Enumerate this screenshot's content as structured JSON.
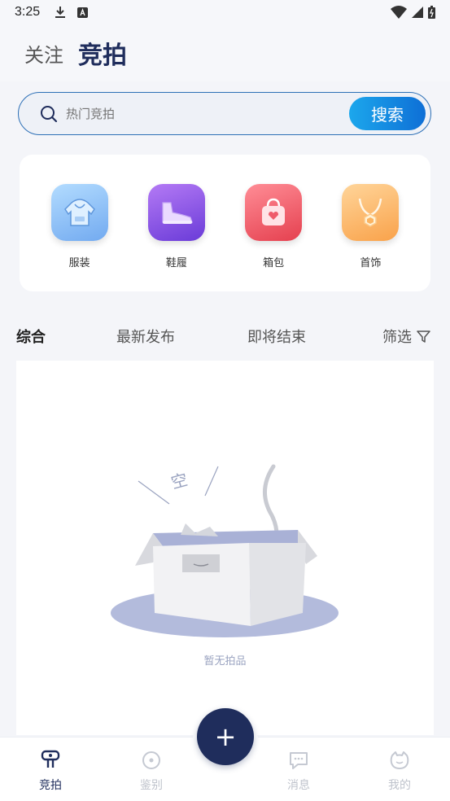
{
  "status_bar": {
    "time": "3:25"
  },
  "header": {
    "follow_label": "关注",
    "auction_label": "竞拍"
  },
  "search": {
    "placeholder": "热门竞拍",
    "button_label": "搜索"
  },
  "categories": [
    {
      "label": "服装",
      "icon": "hoodie-icon",
      "color": "#7fb8f5"
    },
    {
      "label": "鞋履",
      "icon": "sneaker-icon",
      "color": "#8a55e6"
    },
    {
      "label": "箱包",
      "icon": "handbag-icon",
      "color": "#ef5b6a"
    },
    {
      "label": "首饰",
      "icon": "necklace-icon",
      "color": "#fbb462"
    }
  ],
  "sort_tabs": [
    "综合",
    "最新发布",
    "即将结束",
    "筛选"
  ],
  "empty": {
    "badge_text": "空",
    "message": "暂无拍品"
  },
  "bottom_nav": [
    {
      "label": "竞拍",
      "icon": "auction-icon",
      "active": true
    },
    {
      "label": "鉴别",
      "icon": "appraise-icon",
      "active": false
    },
    {
      "label": "消息",
      "icon": "message-icon",
      "active": false
    },
    {
      "label": "我的",
      "icon": "profile-icon",
      "active": false
    }
  ],
  "fab_label": "+",
  "colors": {
    "primary": "#1f2d5c",
    "accent": "#1ca7ec",
    "background": "#f4f5f9"
  }
}
